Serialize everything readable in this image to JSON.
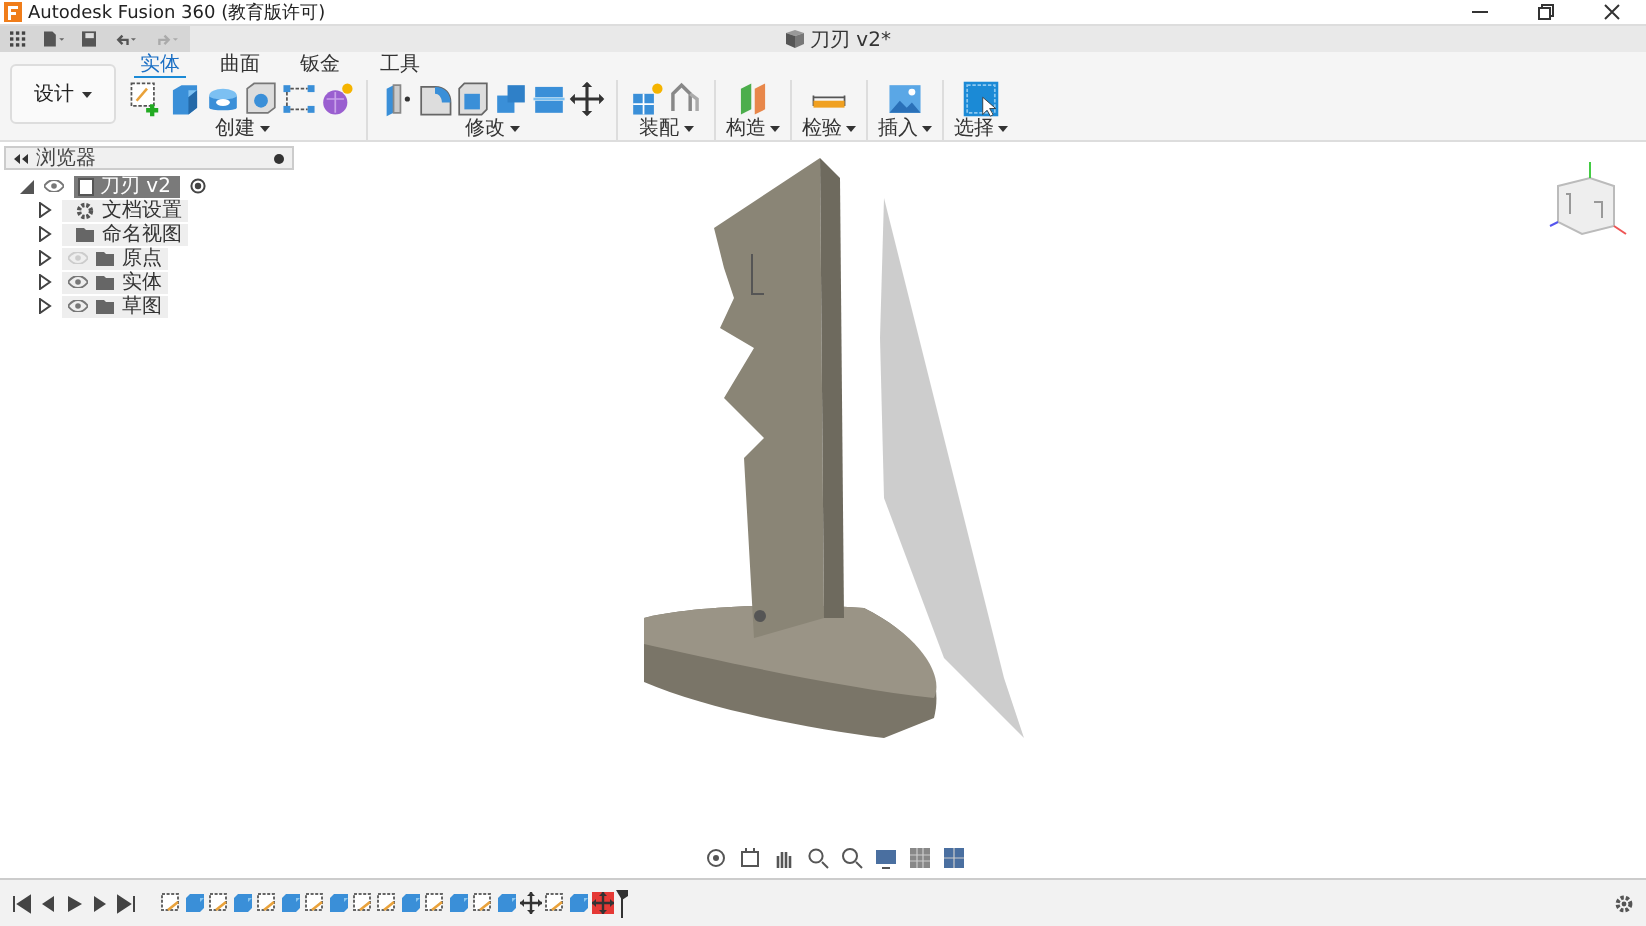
{
  "window": {
    "title": "Autodesk Fusion 360 (教育版许可)"
  },
  "document_tab": {
    "title": "刀刃 v2*"
  },
  "workspace": {
    "label": "设计"
  },
  "ribbon_tabs": [
    {
      "label": "实体",
      "selected": true
    },
    {
      "label": "曲面",
      "selected": false
    },
    {
      "label": "钣金",
      "selected": false
    },
    {
      "label": "工具",
      "selected": false
    }
  ],
  "ribbon_groups": [
    {
      "label": "创建",
      "tools": [
        {
          "kind": "sketch"
        },
        {
          "kind": "box"
        },
        {
          "kind": "extrude"
        },
        {
          "kind": "revolve"
        },
        {
          "kind": "pattern"
        },
        {
          "kind": "form"
        }
      ]
    },
    {
      "label": "修改",
      "tools": [
        {
          "kind": "pressPull"
        },
        {
          "kind": "fillet"
        },
        {
          "kind": "shell"
        },
        {
          "kind": "combine"
        },
        {
          "kind": "split"
        },
        {
          "kind": "move"
        }
      ]
    },
    {
      "label": "装配",
      "tools": [
        {
          "kind": "component"
        },
        {
          "kind": "joint"
        }
      ]
    },
    {
      "label": "构造",
      "tools": [
        {
          "kind": "plane"
        }
      ]
    },
    {
      "label": "检验",
      "tools": [
        {
          "kind": "measure"
        }
      ]
    },
    {
      "label": "插入",
      "tools": [
        {
          "kind": "image"
        }
      ]
    },
    {
      "label": "选择",
      "tools": [
        {
          "kind": "select"
        }
      ]
    }
  ],
  "browser": {
    "title": "浏览器",
    "root": {
      "label": "刀刃 v2",
      "expanded": true,
      "children": [
        {
          "label": "文档设置",
          "kind": "settings",
          "expanded": false
        },
        {
          "label": "命名视图",
          "kind": "folder",
          "expanded": false
        },
        {
          "label": "原点",
          "kind": "folder",
          "visible": false,
          "expanded": false
        },
        {
          "label": "实体",
          "kind": "folder",
          "visible": true,
          "expanded": false
        },
        {
          "label": "草图",
          "kind": "folder",
          "visible": true,
          "expanded": false
        }
      ]
    }
  },
  "timeline": [
    {
      "kind": "sketch",
      "selected": false
    },
    {
      "kind": "body",
      "selected": false
    },
    {
      "kind": "sketch",
      "selected": false
    },
    {
      "kind": "body",
      "selected": false
    },
    {
      "kind": "sketch",
      "selected": false
    },
    {
      "kind": "body",
      "selected": false
    },
    {
      "kind": "sketch",
      "selected": false
    },
    {
      "kind": "body",
      "selected": false
    },
    {
      "kind": "sketch",
      "selected": false
    },
    {
      "kind": "sketch",
      "selected": false
    },
    {
      "kind": "body",
      "selected": false
    },
    {
      "kind": "sketch",
      "selected": false
    },
    {
      "kind": "body",
      "selected": false
    },
    {
      "kind": "sketch",
      "selected": false
    },
    {
      "kind": "body",
      "selected": false
    },
    {
      "kind": "move",
      "selected": false
    },
    {
      "kind": "sketch",
      "selected": false
    },
    {
      "kind": "body",
      "selected": false
    },
    {
      "kind": "move",
      "selected": true
    }
  ]
}
